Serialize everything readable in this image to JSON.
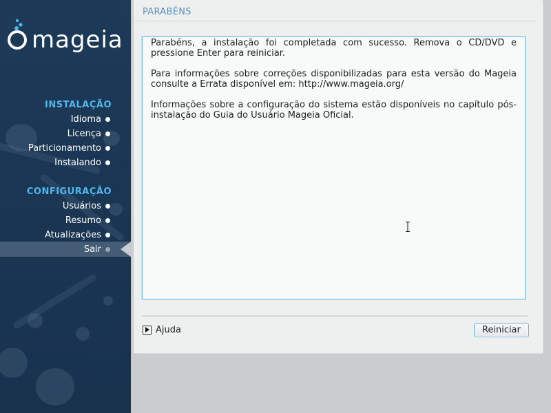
{
  "brand": {
    "name": "mageia",
    "accent_color": "#4fb6ee",
    "sidebar_color": "#1d3a58"
  },
  "sidebar": {
    "sections": [
      {
        "heading": "INSTALAÇÃO",
        "steps": [
          {
            "label": "Idioma"
          },
          {
            "label": "Licença"
          },
          {
            "label": "Particionamento"
          },
          {
            "label": "Instalando"
          }
        ]
      },
      {
        "heading": "CONFIGURAÇÃO",
        "steps": [
          {
            "label": "Usuários"
          },
          {
            "label": "Resumo"
          },
          {
            "label": "Atualizações"
          },
          {
            "label": "Sair",
            "active": true
          }
        ]
      }
    ]
  },
  "page": {
    "title": "PARABÉNS",
    "paragraphs": [
      "Parabéns, a instalação foi completada com sucesso. Remova o CD/DVD e pressione Enter para reiniciar.",
      "Para informações sobre correções disponibilizadas para esta versão do Mageia consulte a Errata disponível em: http://www.mageia.org/",
      "Informações sobre a configuração do sistema estão disponíveis no capítulo pós-instalação do Guia do Usuário Mageia Oficial."
    ]
  },
  "footer": {
    "help_label": "Ajuda",
    "reboot_label": "Reiniciar"
  },
  "icons": {
    "help_toggle": "triangle-right-icon",
    "cursor": "text-cursor-icon",
    "logo": "mageia-logo-icon"
  }
}
